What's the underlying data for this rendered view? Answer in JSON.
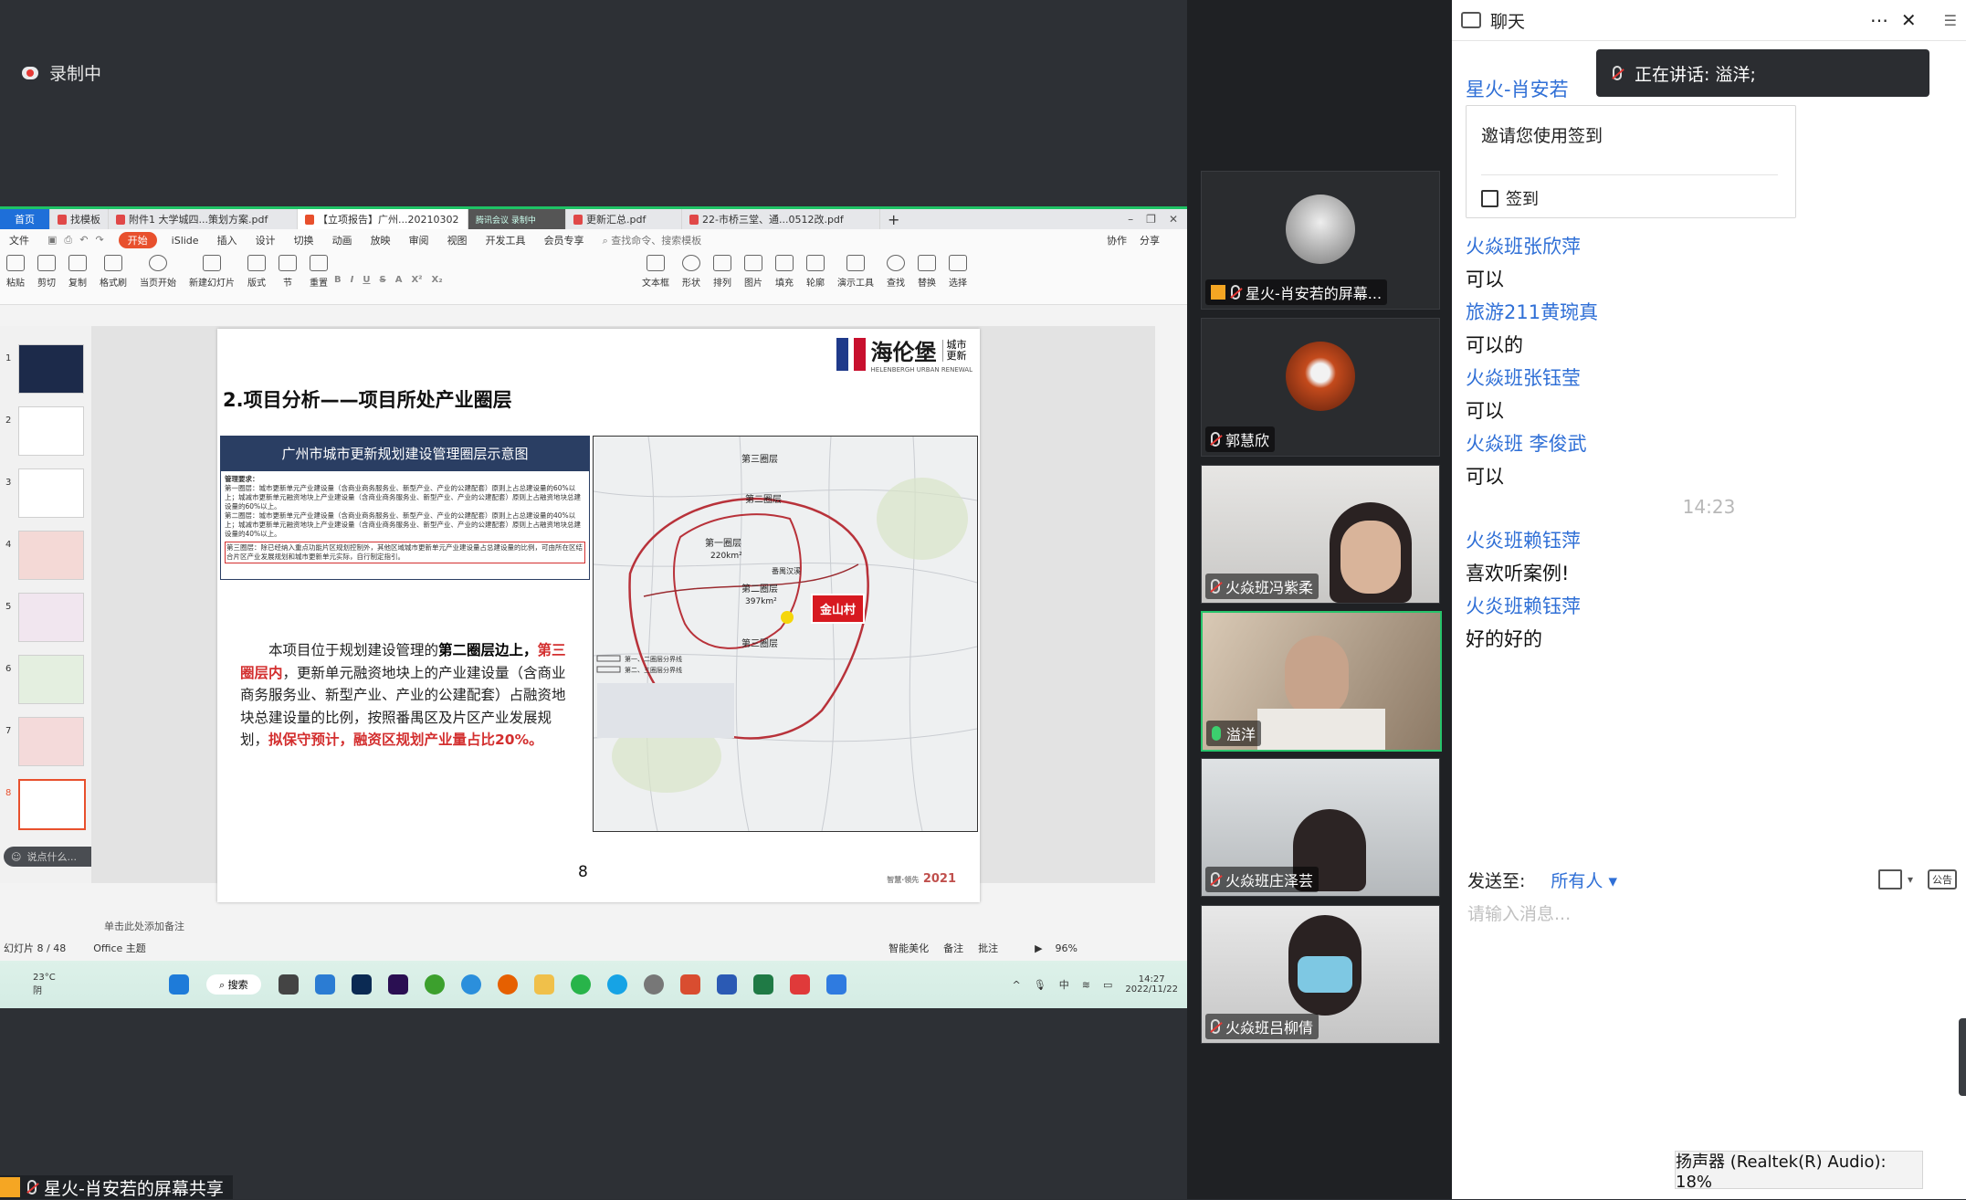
{
  "recording": {
    "label": "录制中"
  },
  "screen": {
    "tabs": [
      {
        "label": "首页"
      },
      {
        "label": "找模板"
      },
      {
        "label": "附件1 大学城四...策划方案.pdf"
      },
      {
        "label": "【立项报告】广州...20210302"
      },
      {
        "label": "更新汇总.pdf"
      },
      {
        "label": "22-市桥三堂、通...0512改.pdf"
      }
    ],
    "meeting_badge": "腾讯会议  录制中",
    "menus": [
      "文件",
      "开始",
      "iSlide",
      "插入",
      "设计",
      "切换",
      "动画",
      "放映",
      "审阅",
      "视图",
      "开发工具",
      "会员专享"
    ],
    "search_placeholder": "查找命令、搜索模板",
    "collab": [
      "协作",
      "分享"
    ],
    "ribbon": [
      "粘贴",
      "剪切",
      "复制",
      "格式刷",
      "当页开始",
      "新建幻灯片",
      "版式",
      "节",
      "重置",
      "文本框",
      "形状",
      "排列",
      "图片",
      "填充",
      "轮廓",
      "演示工具",
      "查找",
      "替换",
      "选择"
    ],
    "thumbnail_numbers": [
      "1",
      "2",
      "3",
      "4",
      "5",
      "6",
      "7",
      "8"
    ],
    "comment_placeholder": "说点什么...",
    "slide": {
      "title": "2.项目分析——项目所处产业圈层",
      "logo_text": "海伦堡",
      "logo_side": "城市更新",
      "logo_sub": "HELENBERGH URBAN RENEWAL",
      "diagram_title": "广州市城市更新规划建设管理圈层示意图",
      "diagram_req_title": "管理要求：",
      "diagram_lines": [
        "第一圈层：城市更新单元产业建设量（含商业商务服务业、新型产业、产业的公建配套）原则上占总建设量的60%以上；城减市更新单元融资地块上产业建设量（含商业商务服务业、新型产业、产业的公建配套）原则上占融资地块总建设量的60%以上。",
        "第二圈层：城市更新单元产业建设量（含商业商务服务业、新型产业、产业的公建配套）原则上占总建设量的40%以上；城减市更新单元融资地块上产业建设量（含商业商务服务业、新型产业、产业的公建配套）原则上占融资地块总建设量的40%以上。"
      ],
      "diagram_note": "第三圈层：除已经纳入重点功能片区规划控制外，其他区域城市更新单元产业建设量占总建设量的比例，可由所在区结合片区产业发展规划和城市更新单元实际，自行制定指引。",
      "body_pre": "本项目位于规划建设管理的",
      "body_bold": "第二圈层边上，",
      "body_red1": "第三圈层内",
      "body_mid": "，更新单元融资地块上的产业建设量（含商业商务服务业、新型产业、产业的公建配套）占融资地块总建设量的比例，按照番禺区及片区产业发展规划，",
      "body_red2": "拟保守预计，融资区规划产业量占比20%。",
      "map_labels": [
        "第三圈层",
        "第二圈层",
        "第一圈层",
        "220km²",
        "第二圈层",
        "397km²",
        "第三圈层",
        "番禺汉溪"
      ],
      "map_tag": "金山村",
      "map_legend": [
        "第一、二圈层分界线",
        "第二、三圈层分界线"
      ],
      "page_number": "8",
      "footer_year": "2021",
      "footer_prefix": "智慧·领先"
    },
    "notes_placeholder": "单击此处添加备注",
    "status": {
      "slide_info": "幻灯片 8 / 48",
      "theme": "Office 主题",
      "beautify": "智能美化",
      "notes": "备注",
      "comment": "批注",
      "zoom": "96%"
    },
    "taskbar": {
      "weather_temp": "23°C",
      "weather_desc": "阴",
      "search": "搜索",
      "time": "14:27",
      "date": "2022/11/22",
      "ime": "中"
    }
  },
  "share_label": "星火-肖安若的屏幕共享",
  "videos": [
    {
      "name": "星火-肖安若的屏幕...",
      "mic": "muted",
      "sharing": true,
      "avatar_color": "#888"
    },
    {
      "name": "郭慧欣",
      "mic": "muted",
      "avatar_color": "#8a3b1e"
    },
    {
      "name": "火焱班冯紫柔",
      "mic": "muted"
    },
    {
      "name": "溢洋",
      "mic": "on",
      "active": true
    },
    {
      "name": "火焱班庄泽芸",
      "mic": "muted"
    },
    {
      "name": "火焱班吕柳倩",
      "mic": "muted"
    }
  ],
  "chat": {
    "title": "聊天",
    "talking_banner": "正在讲话: 溢洋;",
    "first_sender": "星火-肖安若",
    "signin_text": "邀请您使用签到",
    "signin_button": "签到",
    "messages": [
      {
        "sender": "火焱班张欣萍",
        "text": "可以"
      },
      {
        "sender": "旅游211黄琬真",
        "text": "可以的"
      },
      {
        "sender": "火焱班张钰莹",
        "text": "可以"
      },
      {
        "sender": "火焱班  李俊武",
        "text": "可以"
      }
    ],
    "time": "14:23",
    "messages2": [
      {
        "sender": "火炎班赖钰萍",
        "text": "喜欢听案例!"
      },
      {
        "sender": "火炎班赖钰萍",
        "text": "好的好的"
      }
    ],
    "send_to_label": "发送至:",
    "send_to_value": "所有人",
    "input_placeholder": "请输入消息...",
    "announcement": "公告",
    "audio_tip": "扬声器 (Realtek(R) Audio): 18%"
  },
  "colors": {
    "accent": "#2f6fd6",
    "active_border": "#27c46b",
    "wps_orange": "#e8502d",
    "red": "#d32f2f"
  }
}
